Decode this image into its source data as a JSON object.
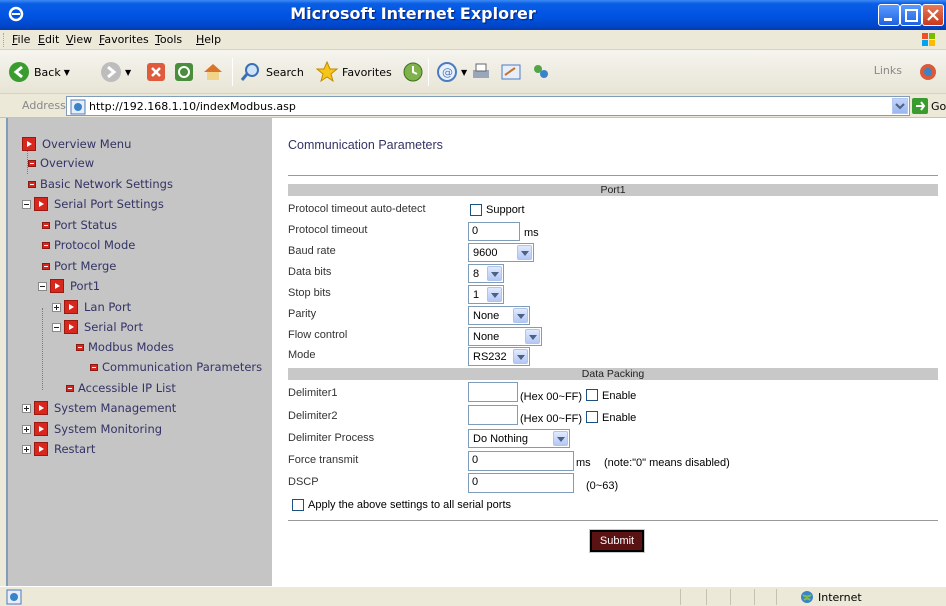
{
  "window": {
    "title": "Microsoft Internet Explorer"
  },
  "menu": [
    "File",
    "Edit",
    "View",
    "Favorites",
    "Tools",
    "Help"
  ],
  "toolbar": {
    "back": "Back",
    "search": "Search",
    "favorites": "Favorites",
    "links": "Links"
  },
  "address": {
    "label": "Address",
    "url": "http://192.168.1.10/indexModbus.asp",
    "go": "Go"
  },
  "sidebar": {
    "overview_menu": "Overview Menu",
    "overview": "Overview",
    "basic_network": "Basic Network Settings",
    "serial_port_settings": "Serial Port Settings",
    "port_status": "Port Status",
    "protocol_mode": "Protocol Mode",
    "port_merge": "Port Merge",
    "port1": "Port1",
    "lan_port": "Lan Port",
    "serial_port": "Serial Port",
    "modbus_modes": "Modbus Modes",
    "comm_params": "Communication Parameters",
    "accessible_ip": "Accessible IP List",
    "system_management": "System Management",
    "system_monitoring": "System Monitoring",
    "restart": "Restart"
  },
  "main": {
    "title": "Communication Parameters",
    "port_section": "Port1",
    "packing_section": "Data Packing",
    "fields": {
      "timeout_auto": {
        "label": "Protocol timeout auto-detect",
        "checkbox": "Support",
        "checked": false
      },
      "timeout": {
        "label": "Protocol timeout",
        "value": "0",
        "unit": "ms"
      },
      "baud": {
        "label": "Baud rate",
        "value": "9600"
      },
      "data_bits": {
        "label": "Data bits",
        "value": "8"
      },
      "stop_bits": {
        "label": "Stop bits",
        "value": "1"
      },
      "parity": {
        "label": "Parity",
        "value": "None"
      },
      "flow": {
        "label": "Flow control",
        "value": "None"
      },
      "mode": {
        "label": "Mode",
        "value": "RS232"
      },
      "delim1": {
        "label": "Delimiter1",
        "value": "",
        "hint": "(Hex 00~FF)",
        "checkbox": "Enable",
        "checked": false
      },
      "delim2": {
        "label": "Delimiter2",
        "value": "",
        "hint": "(Hex 00~FF)",
        "checkbox": "Enable",
        "checked": false
      },
      "delim_process": {
        "label": "Delimiter Process",
        "value": "Do Nothing"
      },
      "force_tx": {
        "label": "Force transmit",
        "value": "0",
        "unit": "ms",
        "note": "(note:\"0\" means disabled)"
      },
      "dscp": {
        "label": "DSCP",
        "value": "0",
        "note": "(0~63)"
      }
    },
    "apply_all": {
      "label": "Apply the above settings to all serial ports",
      "checked": false
    },
    "submit": "Submit"
  },
  "status": {
    "zone": "Internet"
  }
}
